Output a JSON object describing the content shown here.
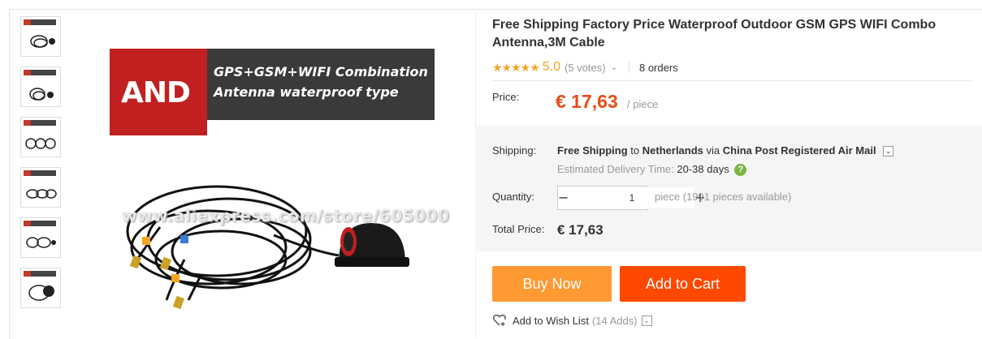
{
  "gallery": {
    "banner_logo": "AND",
    "banner_line1": "GPS+GSM+WIFI Combination",
    "banner_line2": "Antenna waterproof type",
    "watermark": "www.aliexpress.com/store/605000",
    "thumbnail_count": 6
  },
  "product": {
    "title": "Free Shipping Factory Price Waterproof Outdoor GSM GPS WIFI Combo Antenna,3M Cable",
    "stars": "★★★★★",
    "rating": "5.0",
    "votes": "(5 votes)",
    "orders": "8 orders"
  },
  "price": {
    "label": "Price:",
    "value": "€ 17,63",
    "unit": "/ piece"
  },
  "shipping": {
    "label": "Shipping:",
    "prefix": "Free Shipping",
    "to": "to",
    "destination": "Netherlands",
    "via": "via",
    "method": "China Post Registered Air Mail",
    "est_label": "Estimated Delivery Time:",
    "est_days": "20-38 days"
  },
  "quantity": {
    "label": "Quantity:",
    "minus": "−",
    "value": "1",
    "plus": "+",
    "note": "piece (1991 pieces available)"
  },
  "total": {
    "label": "Total Price:",
    "value": "€ 17,63"
  },
  "actions": {
    "buy_now": "Buy Now",
    "add_to_cart": "Add to Cart",
    "wishlist": "Add to Wish List",
    "wishlist_count": "(14 Adds)"
  },
  "colors": {
    "price": "#e64c15",
    "buy_now": "#ff9932",
    "add_to_cart": "#ff4800",
    "stars": "#f5a623"
  }
}
